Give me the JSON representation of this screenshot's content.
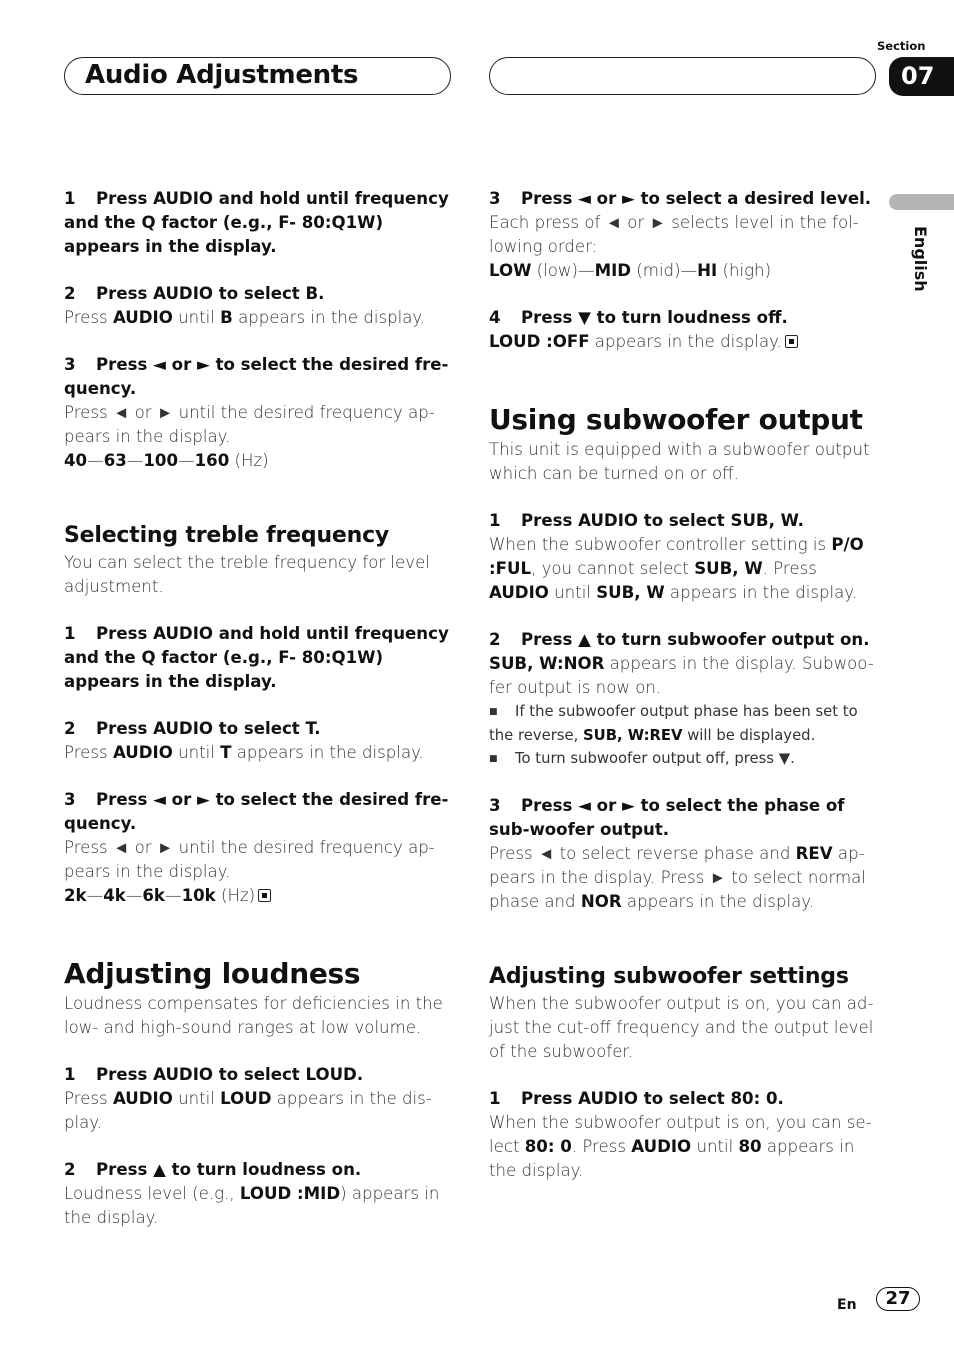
{
  "header": {
    "title": "Audio Adjustments",
    "section_label": "Section",
    "section_number": "07",
    "language": "English"
  },
  "footer": {
    "language_code": "En",
    "page_number": "27"
  },
  "left_column": [
    {
      "type": "step",
      "num": "1",
      "text": "Press AUDIO and hold until frequency and the Q factor (e.g., F- 80:Q1W) appears in the display."
    },
    {
      "type": "gap"
    },
    {
      "type": "step",
      "num": "2",
      "text": "Press AUDIO to select B."
    },
    {
      "type": "para",
      "segments": [
        [
          "Press ",
          false
        ],
        [
          "AUDIO",
          true
        ],
        [
          " until ",
          false
        ],
        [
          "B",
          true
        ],
        [
          " appears in the display.",
          false
        ]
      ]
    },
    {
      "type": "gap"
    },
    {
      "type": "step",
      "num": "3",
      "text": "Press ◄ or ► to select the desired fre-quency."
    },
    {
      "type": "para",
      "segments": [
        [
          "Press ◄ or ► until the desired frequency ap-pears in the display.",
          false
        ]
      ]
    },
    {
      "type": "para",
      "segments": [
        [
          "40",
          true
        ],
        [
          "—",
          false
        ],
        [
          "63",
          true
        ],
        [
          "—",
          false
        ],
        [
          "100",
          true
        ],
        [
          "—",
          false
        ],
        [
          "160",
          true
        ],
        [
          " (Hz)",
          false
        ]
      ]
    },
    {
      "type": "gap-l"
    },
    {
      "type": "h3",
      "text": "Selecting treble frequency"
    },
    {
      "type": "para",
      "segments": [
        [
          "You can select the treble frequency for level adjustment.",
          false
        ]
      ]
    },
    {
      "type": "gap"
    },
    {
      "type": "step",
      "num": "1",
      "text": "Press AUDIO and hold until frequency and the Q factor (e.g., F- 80:Q1W) appears in the display."
    },
    {
      "type": "gap"
    },
    {
      "type": "step",
      "num": "2",
      "text": "Press AUDIO to select T."
    },
    {
      "type": "para",
      "segments": [
        [
          "Press ",
          false
        ],
        [
          "AUDIO",
          true
        ],
        [
          " until ",
          false
        ],
        [
          "T",
          true
        ],
        [
          " appears in the display.",
          false
        ]
      ]
    },
    {
      "type": "gap"
    },
    {
      "type": "step",
      "num": "3",
      "text": "Press ◄ or ► to select the desired fre-quency."
    },
    {
      "type": "para",
      "segments": [
        [
          "Press ◄ or ► until the desired frequency ap-pears in the display.",
          false
        ]
      ]
    },
    {
      "type": "para",
      "end_icon": true,
      "segments": [
        [
          "2k",
          true
        ],
        [
          "—",
          false
        ],
        [
          "4k",
          true
        ],
        [
          "—",
          false
        ],
        [
          "6k",
          true
        ],
        [
          "—",
          false
        ],
        [
          "10k",
          true
        ],
        [
          " (Hz)",
          false
        ]
      ]
    },
    {
      "type": "gap-l"
    },
    {
      "type": "h2",
      "text": "Adjusting loudness"
    },
    {
      "type": "para",
      "segments": [
        [
          "Loudness compensates for deficiencies in the low- and high-sound ranges at low volume.",
          false
        ]
      ]
    },
    {
      "type": "gap"
    },
    {
      "type": "step",
      "num": "1",
      "text": "Press AUDIO to select LOUD."
    },
    {
      "type": "para",
      "segments": [
        [
          "Press ",
          false
        ],
        [
          "AUDIO",
          true
        ],
        [
          " until ",
          false
        ],
        [
          "LOUD",
          true
        ],
        [
          " appears in the dis-play.",
          false
        ]
      ]
    },
    {
      "type": "gap"
    },
    {
      "type": "step",
      "num": "2",
      "text": "Press ▲ to turn loudness on."
    },
    {
      "type": "para",
      "segments": [
        [
          "Loudness level (e.g., ",
          false
        ],
        [
          "LOUD :MID",
          true
        ],
        [
          ") appears in the display.",
          false
        ]
      ]
    }
  ],
  "right_column": [
    {
      "type": "step",
      "num": "3",
      "text": "Press ◄ or ► to select a desired level."
    },
    {
      "type": "para",
      "segments": [
        [
          "Each press of ◄ or ► selects level in the fol-lowing order:",
          false
        ]
      ]
    },
    {
      "type": "para",
      "segments": [
        [
          "LOW",
          true
        ],
        [
          " (low)—",
          false
        ],
        [
          "MID",
          true
        ],
        [
          " (mid)—",
          false
        ],
        [
          "HI",
          true
        ],
        [
          " (high)",
          false
        ]
      ]
    },
    {
      "type": "gap"
    },
    {
      "type": "step",
      "num": "4",
      "text": "Press ▼ to turn loudness off."
    },
    {
      "type": "para",
      "end_icon": true,
      "segments": [
        [
          "LOUD :OFF",
          true
        ],
        [
          " appears in the display.",
          false
        ]
      ]
    },
    {
      "type": "gap-l"
    },
    {
      "type": "h2",
      "text": "Using subwoofer output"
    },
    {
      "type": "para",
      "segments": [
        [
          "This unit is equipped with a subwoofer output which can be turned on or off.",
          false
        ]
      ]
    },
    {
      "type": "gap"
    },
    {
      "type": "step",
      "num": "1",
      "text": "Press AUDIO to select SUB, W."
    },
    {
      "type": "para",
      "segments": [
        [
          "When the subwoofer controller setting is ",
          false
        ],
        [
          "P/O :FUL",
          true
        ],
        [
          ", you cannot select ",
          false
        ],
        [
          "SUB, W",
          true
        ],
        [
          ". Press ",
          false
        ],
        [
          "AUDIO",
          true
        ],
        [
          " until ",
          false
        ],
        [
          "SUB, W",
          true
        ],
        [
          " appears in the display.",
          false
        ]
      ]
    },
    {
      "type": "gap"
    },
    {
      "type": "step",
      "num": "2",
      "text": "Press ▲ to turn subwoofer output on."
    },
    {
      "type": "para",
      "segments": [
        [
          "SUB, W:NOR",
          true
        ],
        [
          " appears in the display. Subwoo-fer output is now on.",
          false
        ]
      ]
    },
    {
      "type": "note",
      "segments": [
        [
          "If the subwoofer output phase has been set to the reverse, ",
          false
        ],
        [
          "SUB, W:REV",
          true
        ],
        [
          " will be displayed.",
          false
        ]
      ]
    },
    {
      "type": "note",
      "segments": [
        [
          "To turn subwoofer output off, press ▼.",
          false
        ]
      ]
    },
    {
      "type": "gap"
    },
    {
      "type": "step",
      "num": "3",
      "text": "Press ◄ or ► to select the phase of sub-woofer output."
    },
    {
      "type": "para",
      "segments": [
        [
          "Press ◄ to select reverse phase and ",
          false
        ],
        [
          "REV",
          true
        ],
        [
          " ap-pears in the display. Press ► to select normal phase and ",
          false
        ],
        [
          "NOR",
          true
        ],
        [
          " appears in the display.",
          false
        ]
      ]
    },
    {
      "type": "gap-l"
    },
    {
      "type": "h3",
      "text": "Adjusting subwoofer settings"
    },
    {
      "type": "para",
      "segments": [
        [
          "When the subwoofer output is on, you can ad-just the cut-off frequency and the output level of the subwoofer.",
          false
        ]
      ]
    },
    {
      "type": "gap"
    },
    {
      "type": "step",
      "num": "1",
      "text": "Press AUDIO to select 80: 0."
    },
    {
      "type": "para",
      "segments": [
        [
          "When the subwoofer output is on, you can se-lect ",
          false
        ],
        [
          "80: 0",
          true
        ],
        [
          ". Press ",
          false
        ],
        [
          "AUDIO",
          true
        ],
        [
          " until ",
          false
        ],
        [
          "80",
          true
        ],
        [
          " appears in the display.",
          false
        ]
      ]
    }
  ]
}
